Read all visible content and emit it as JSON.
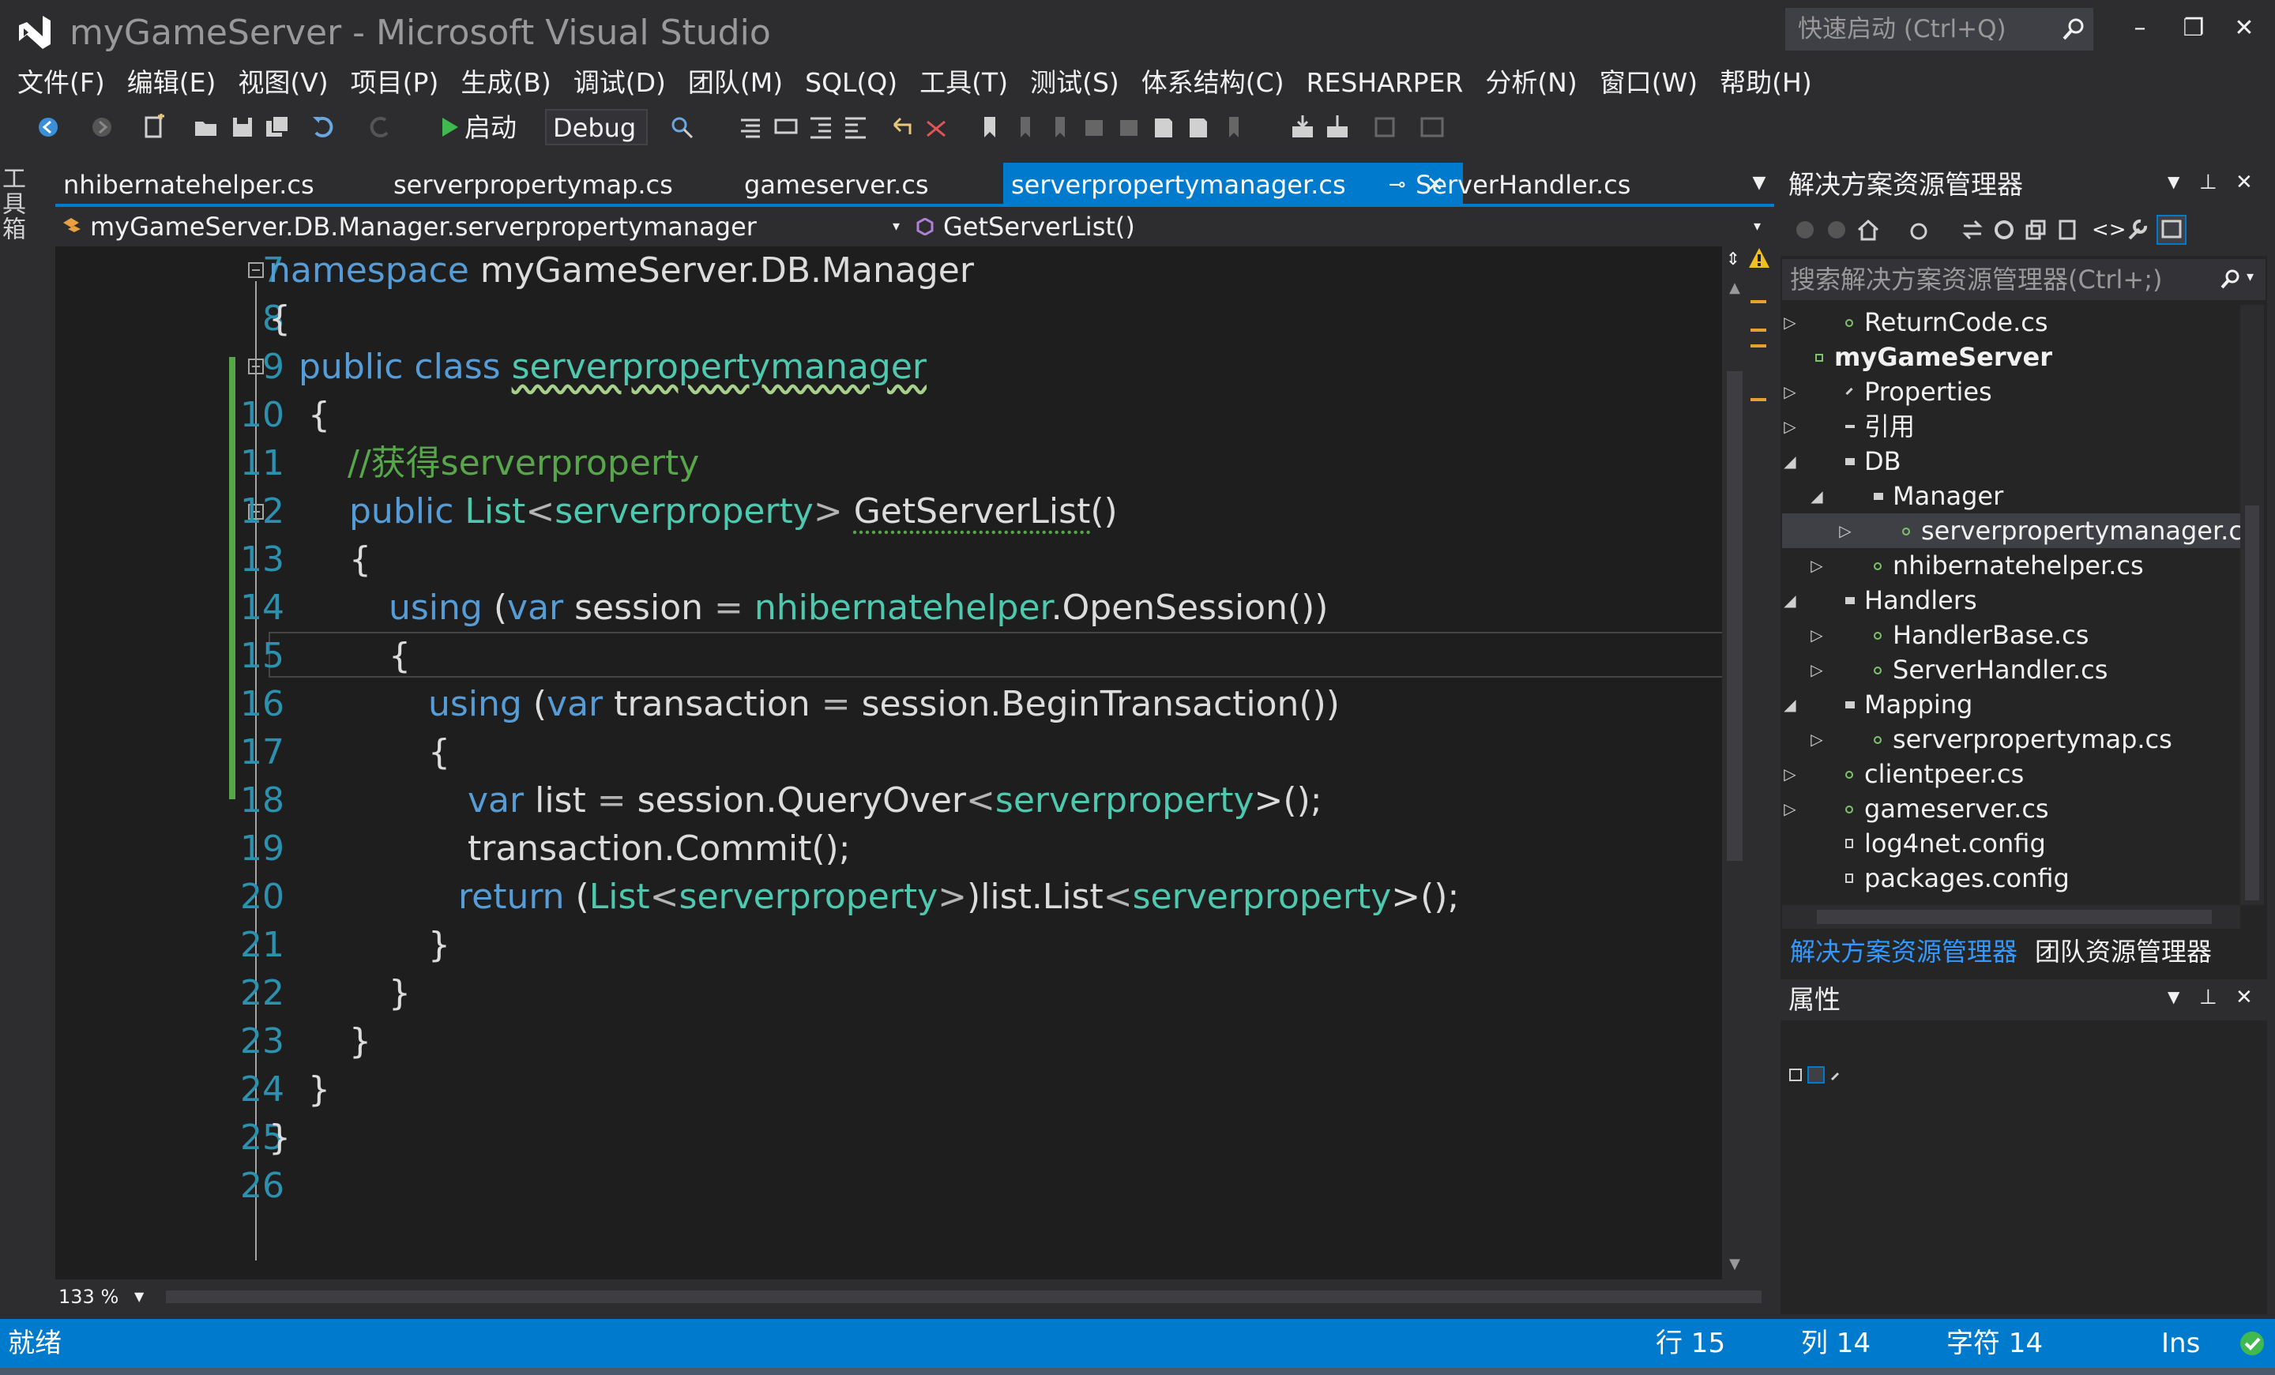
{
  "window": {
    "title": "myGameServer - Microsoft Visual Studio",
    "quick_launch_placeholder": "快速启动 (Ctrl+Q)",
    "minimize_label": "–",
    "restore_label": "❐",
    "close_label": "✕"
  },
  "menu": [
    "文件(F)",
    "编辑(E)",
    "视图(V)",
    "项目(P)",
    "生成(B)",
    "调试(D)",
    "团队(M)",
    "SQL(Q)",
    "工具(T)",
    "测试(S)",
    "体系结构(C)",
    "RESHARPER",
    "分析(N)",
    "窗口(W)",
    "帮助(H)"
  ],
  "toolbar": {
    "start_label": "启动",
    "configuration": "Debug"
  },
  "toolbox_label": "工具箱",
  "tabs": [
    {
      "label": "nhibernatehelper.cs",
      "active": false
    },
    {
      "label": "serverpropertymap.cs",
      "active": false
    },
    {
      "label": "gameserver.cs",
      "active": false
    },
    {
      "label": "serverpropertymanager.cs",
      "active": true
    },
    {
      "label": "ServerHandler.cs",
      "active": false
    }
  ],
  "tab_pin_icon": "⊸",
  "tab_close_icon": "✕",
  "navbar": {
    "type_scope": "myGameServer.DB.Manager.serverpropertymanager",
    "member_scope": "GetServerList()"
  },
  "editor": {
    "zoom": "133 %",
    "lines": [
      {
        "n": "7"
      },
      {
        "n": "8"
      },
      {
        "n": "9"
      },
      {
        "n": "10"
      },
      {
        "n": "11"
      },
      {
        "n": "12"
      },
      {
        "n": "13"
      },
      {
        "n": "14"
      },
      {
        "n": "15"
      },
      {
        "n": "16"
      },
      {
        "n": "17"
      },
      {
        "n": "18"
      },
      {
        "n": "19"
      },
      {
        "n": "20"
      },
      {
        "n": "21"
      },
      {
        "n": "22"
      },
      {
        "n": "23"
      },
      {
        "n": "24"
      },
      {
        "n": "25"
      },
      {
        "n": "26"
      }
    ],
    "code": {
      "l7_kw": "namespace",
      "l7_name": "myGameServer.DB.Manager",
      "l8": "{",
      "l9_kw": "public class",
      "l9_name": "serverpropertymanager",
      "l10": "{",
      "l11": "//获得serverproperty",
      "l12_kw": "public",
      "l12_type": "List",
      "l12_lt": "<",
      "l12_arg": "serverproperty",
      "l12_gt": ">",
      "l12_name": "GetServerList",
      "l12_end": "()",
      "l13": "{",
      "l14_kw": "using",
      "l14_p1": "(",
      "l14_var": "var",
      "l14_mid": "session",
      "l14_eq": "=",
      "l14_type": "nhibernatehelper",
      "l14_end": ".OpenSession())",
      "l15": "{",
      "l16_kw": "using",
      "l16_p1": "(",
      "l16_var": "var",
      "l16_mid": "transaction",
      "l16_eq": "=",
      "l16_end": "session.BeginTransaction())",
      "l17": "{",
      "l18_var": "var",
      "l18_mid": "list",
      "l18_eq": "=",
      "l18_call": "session.QueryOver",
      "l18_lt": "<",
      "l18_type": "serverproperty",
      "l18_end": ">();",
      "l19": "transaction.Commit();",
      "l20_kw": "return",
      "l20_p1": "(",
      "l20_type1": "List",
      "l20_lt1": "<",
      "l20_arg1": "serverproperty",
      "l20_gt1": ">",
      "l20_mid": ")list.List",
      "l20_lt2": "<",
      "l20_arg2": "serverproperty",
      "l20_end": ">();",
      "l21": "}",
      "l22": "}",
      "l23": "}",
      "l24": "}",
      "l25": "}"
    }
  },
  "solution_explorer": {
    "title": "解决方案资源管理器",
    "search_placeholder": "搜索解决方案资源管理器(Ctrl+;)",
    "tree": [
      {
        "label": "ReturnCode.cs",
        "expander": "▷"
      },
      {
        "label": "myGameServer",
        "expander": "◢"
      },
      {
        "label": "Properties",
        "expander": "▷"
      },
      {
        "label": "引用",
        "expander": "▷"
      },
      {
        "label": "DB",
        "expander": "◢"
      },
      {
        "label": "Manager",
        "expander": "◢"
      },
      {
        "label": "serverpropertymanager.cs",
        "expander": "▷"
      },
      {
        "label": "nhibernatehelper.cs",
        "expander": "▷"
      },
      {
        "label": "Handlers",
        "expander": "◢"
      },
      {
        "label": "HandlerBase.cs",
        "expander": "▷"
      },
      {
        "label": "ServerHandler.cs",
        "expander": "▷"
      },
      {
        "label": "Mapping",
        "expander": "◢"
      },
      {
        "label": "serverpropertymap.cs",
        "expander": "▷"
      },
      {
        "label": "clientpeer.cs",
        "expander": "▷"
      },
      {
        "label": "gameserver.cs",
        "expander": "▷"
      },
      {
        "label": "log4net.config",
        "expander": ""
      },
      {
        "label": "packages.config",
        "expander": ""
      }
    ],
    "bottom_tabs": [
      "解决方案资源管理器",
      "团队资源管理器"
    ]
  },
  "properties": {
    "title": "属性"
  },
  "statusbar": {
    "ready": "就绪",
    "line": "行 15",
    "col": "列 14",
    "char": "字符 14",
    "mode": "Ins"
  },
  "colors": {
    "accent": "#007acc",
    "keyword": "#569cd6",
    "type": "#4ec9b0",
    "comment": "#57a64a",
    "line_number": "#2b91af"
  }
}
